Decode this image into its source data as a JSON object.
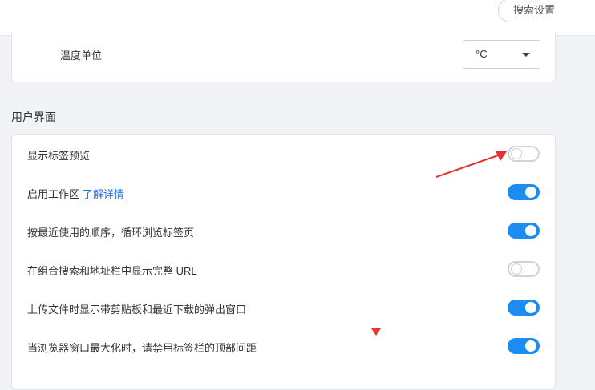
{
  "header": {
    "search_placeholder": "搜索设置"
  },
  "temperature": {
    "label": "温度单位",
    "selected": "°C"
  },
  "ui_section": {
    "title": "用户界面",
    "rows": [
      {
        "label": "显示标签预览",
        "on": false
      },
      {
        "label": "启用工作区",
        "link": "了解详情",
        "on": true
      },
      {
        "label": "按最近使用的顺序，循环浏览标签页",
        "on": true
      },
      {
        "label": "在组合搜索和地址栏中显示完整 URL",
        "on": false
      },
      {
        "label": "上传文件时显示带剪贴板和最近下载的弹出窗口",
        "on": true
      },
      {
        "label": "当浏览器窗口最大化时，请禁用标签栏的顶部间距",
        "on": true
      }
    ]
  },
  "colors": {
    "toggle_on": "#1a8cf2",
    "annotation": "#e33333"
  },
  "icons": {
    "annotation_arrow": "red-arrow-icon",
    "annotation_marker": "red-triangle-icon",
    "dropdown": "caret-down-icon"
  }
}
